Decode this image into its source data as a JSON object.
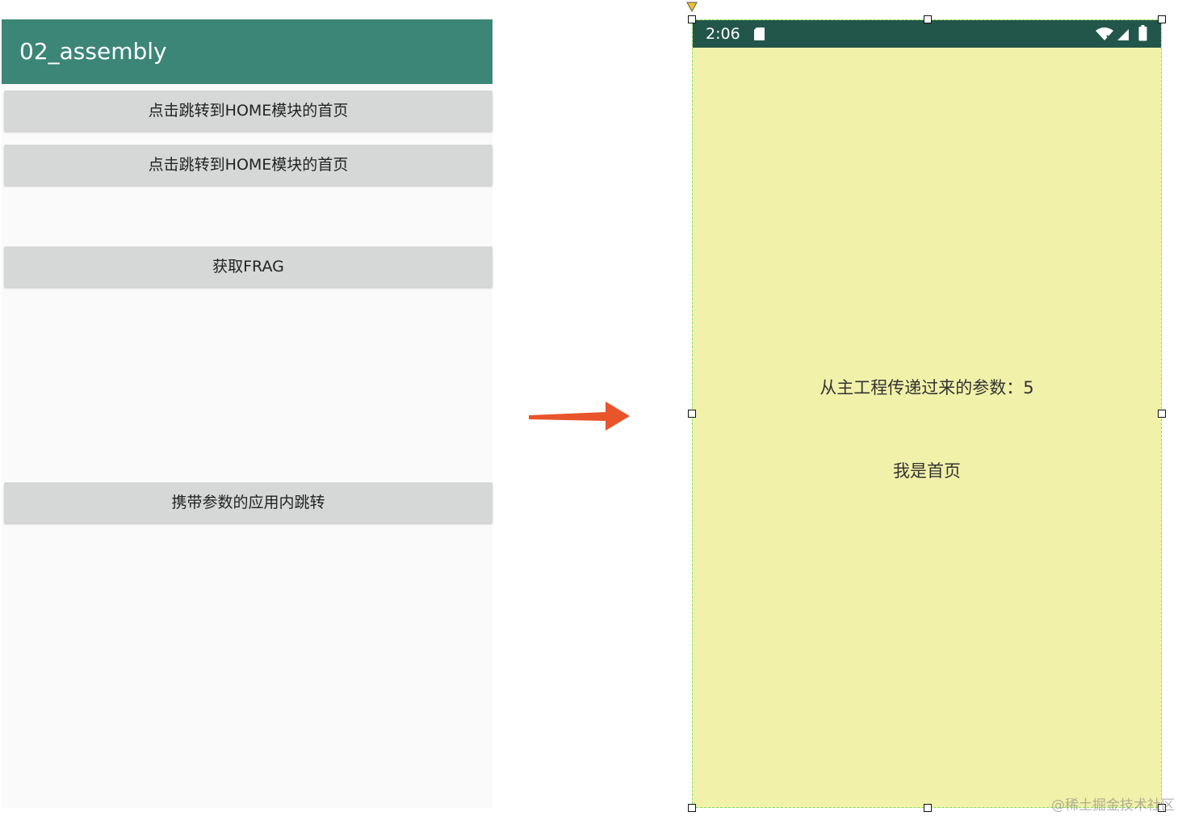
{
  "left_app": {
    "title": "02_assembly",
    "buttons": [
      {
        "label": "点击跳转到HOME模块的首页"
      },
      {
        "label": "点击跳转到HOME模块的首页"
      },
      {
        "label": "获取FRAG"
      },
      {
        "label": "携带参数的应用内跳转"
      }
    ]
  },
  "right_device": {
    "status_time": "2:06",
    "param_text": "从主工程传递过来的参数：5",
    "home_text": "我是首页"
  },
  "watermark": "@稀土掘金技术社区",
  "colors": {
    "appbar": "#3c8677",
    "statusbar": "#23564a",
    "device_bg": "#f2f1aa",
    "arrow": "#e9542a",
    "selection_border": "#7fe06a"
  }
}
